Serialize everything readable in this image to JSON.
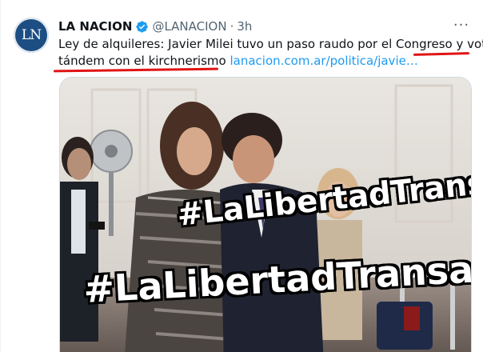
{
  "tweet": {
    "author_name": "LA NACION",
    "avatar_text": "LN",
    "handle": "@LANACION",
    "separator": "·",
    "time": "3h",
    "more_label": "···",
    "text_line1_prefix": "Ley de alquileres: Javier Milei tuvo un paso raudo por el Congreso",
    "text_line1_highlight": " y votó en",
    "text_line2_highlight": "tándem con el kirchnerismo",
    "link_text": "lanacion.com.ar/politica/javie…",
    "colors": {
      "link": "#1d9bf0",
      "verified": "#1d9bf0",
      "avatar_bg": "#1c4e83",
      "annotation_underline": "#e01414"
    },
    "verified_icon": "verified-badge-icon"
  },
  "image": {
    "overlay_text_1": "#LaLibertadTransa",
    "overlay_text_2": "#LaLibertadTransa"
  }
}
